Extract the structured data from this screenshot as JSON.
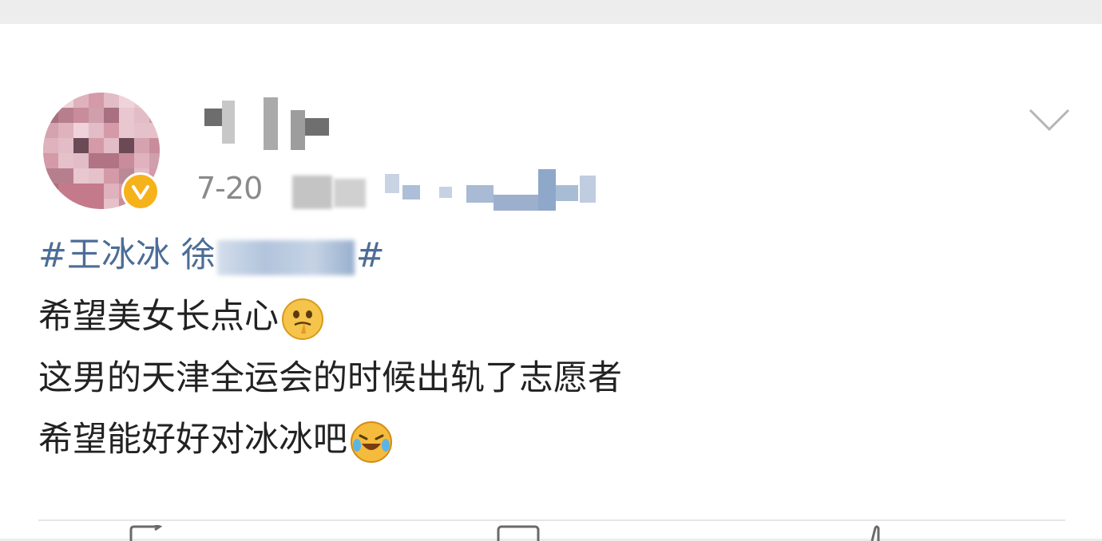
{
  "post": {
    "author": {
      "avatar_icon": "pixelated-avatar",
      "verified_icon": "verified-v-icon",
      "verified_color": "#f6b21a"
    },
    "time": "7-20",
    "menu_icon": "chevron-down-icon",
    "topic": {
      "prefix": "#王冰冰 徐",
      "suffix": "#",
      "color": "#4c6d96"
    },
    "lines": [
      "希望美女长点心",
      "这男的天津全运会的时候出轨了志愿者",
      "希望能好好对冰冰吧"
    ],
    "emojis": [
      "thinking-face-icon",
      "laughing-crying-face-icon"
    ]
  },
  "actions": [
    "repost-icon",
    "comment-icon",
    "like-icon"
  ]
}
